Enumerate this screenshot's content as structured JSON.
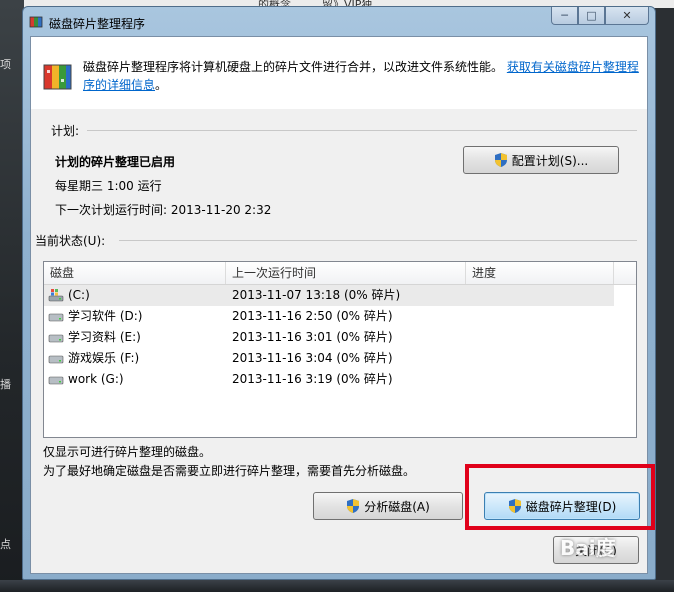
{
  "desktop": {
    "top_texts": [
      "的概念",
      "留》VIP独..."
    ],
    "left_texts": [
      "项",
      "播",
      "点"
    ]
  },
  "window": {
    "title": "磁盘碎片整理程序",
    "caption": {
      "minimize": "─",
      "maximize": "□",
      "close": "✕"
    }
  },
  "description": {
    "text": "磁盘碎片整理程序将计算机硬盘上的碎片文件进行合并，以改进文件系统性能。",
    "link": "获取有关磁盘碎片整理程序的详细信息",
    "suffix": "。"
  },
  "schedule": {
    "label": "计划:",
    "status": "计划的碎片整理已启用",
    "frequency": "每星期三  1:00 运行",
    "next_run": "下一次计划运行时间: 2013-11-20 2:32",
    "configure_button": "配置计划(S)..."
  },
  "current_status": {
    "label": "当前状态(U):",
    "columns": [
      "磁盘",
      "上一次运行时间",
      "进度"
    ],
    "rows": [
      {
        "disk": "(C:)",
        "last_run": "2013-11-07 13:18 (0% 碎片)",
        "progress": "",
        "icon": "system-drive-icon"
      },
      {
        "disk": "学习软件 (D:)",
        "last_run": "2013-11-16 2:50 (0% 碎片)",
        "progress": "",
        "icon": "hard-drive-icon"
      },
      {
        "disk": "学习资料 (E:)",
        "last_run": "2013-11-16 3:01 (0% 碎片)",
        "progress": "",
        "icon": "hard-drive-icon"
      },
      {
        "disk": "游戏娱乐 (F:)",
        "last_run": "2013-11-16 3:04 (0% 碎片)",
        "progress": "",
        "icon": "hard-drive-icon"
      },
      {
        "disk": "work (G:)",
        "last_run": "2013-11-16 3:19 (0% 碎片)",
        "progress": "",
        "icon": "hard-drive-icon"
      }
    ]
  },
  "hints": [
    "仅显示可进行碎片整理的磁盘。",
    "为了最好地确定磁盘是否需要立即进行碎片整理，需要首先分析磁盘。"
  ],
  "buttons": {
    "analyze": "分析磁盘(A)",
    "defrag": "磁盘碎片整理(D)",
    "close": "关闭(C)"
  },
  "watermark": "Bai度"
}
